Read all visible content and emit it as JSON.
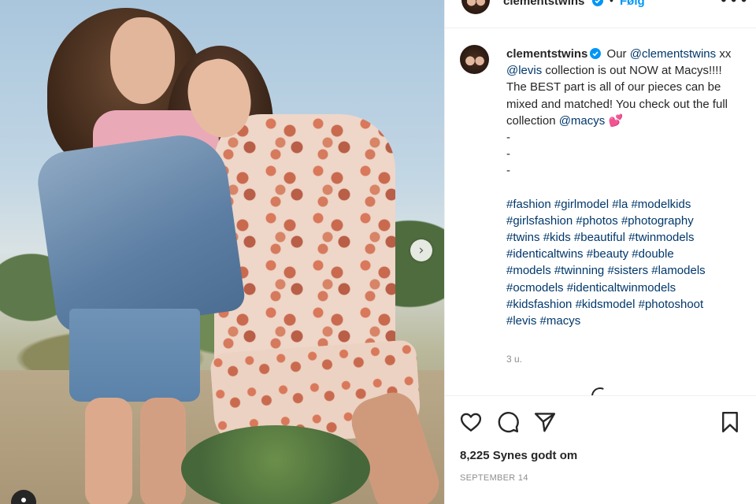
{
  "post": {
    "username": "clementstwins",
    "follow_label": "Følg",
    "dot": "•",
    "more_label": "•••",
    "next_glyph": "›",
    "verified_icon": "verified-badge-icon",
    "accent_color": "#0095f6",
    "link_color": "#00376b"
  },
  "caption": {
    "username": "clementstwins",
    "part1": " Our ",
    "mention1": "@clementstwins",
    "part2": " xx ",
    "mention2": "@levis",
    "part3": " collection is out NOW at Macys!!!! The BEST part is all of our pieces can be mixed and matched! You check out the full collection ",
    "mention3": "@macys",
    "emoji": "💕",
    "dashes": [
      "-",
      "-",
      "-"
    ],
    "hashtag_lines": [
      [
        "#fashion",
        "#girlmodel",
        "#la",
        "#modelkids"
      ],
      [
        "#girlsfashion",
        "#photos",
        "#photography"
      ],
      [
        "#twins",
        "#kids",
        "#beautiful",
        "#twinmodels"
      ],
      [
        "#identicaltwins",
        "#beauty",
        "#double"
      ],
      [
        "#models",
        "#twinning",
        "#sisters",
        "#lamodels"
      ],
      [
        "#ocmodels",
        "#identicaltwinmodels"
      ],
      [
        "#kidsfashion",
        "#kidsmodel",
        "#photoshoot"
      ],
      [
        "#levis",
        "#macys"
      ]
    ],
    "time_ago": "3 u."
  },
  "actions": {
    "like_icon": "heart-icon",
    "comment_icon": "comment-icon",
    "share_icon": "send-icon",
    "save_icon": "bookmark-icon",
    "likes_text": "8,225 Synes godt om",
    "date_text": "SEPTEMBER 14"
  }
}
